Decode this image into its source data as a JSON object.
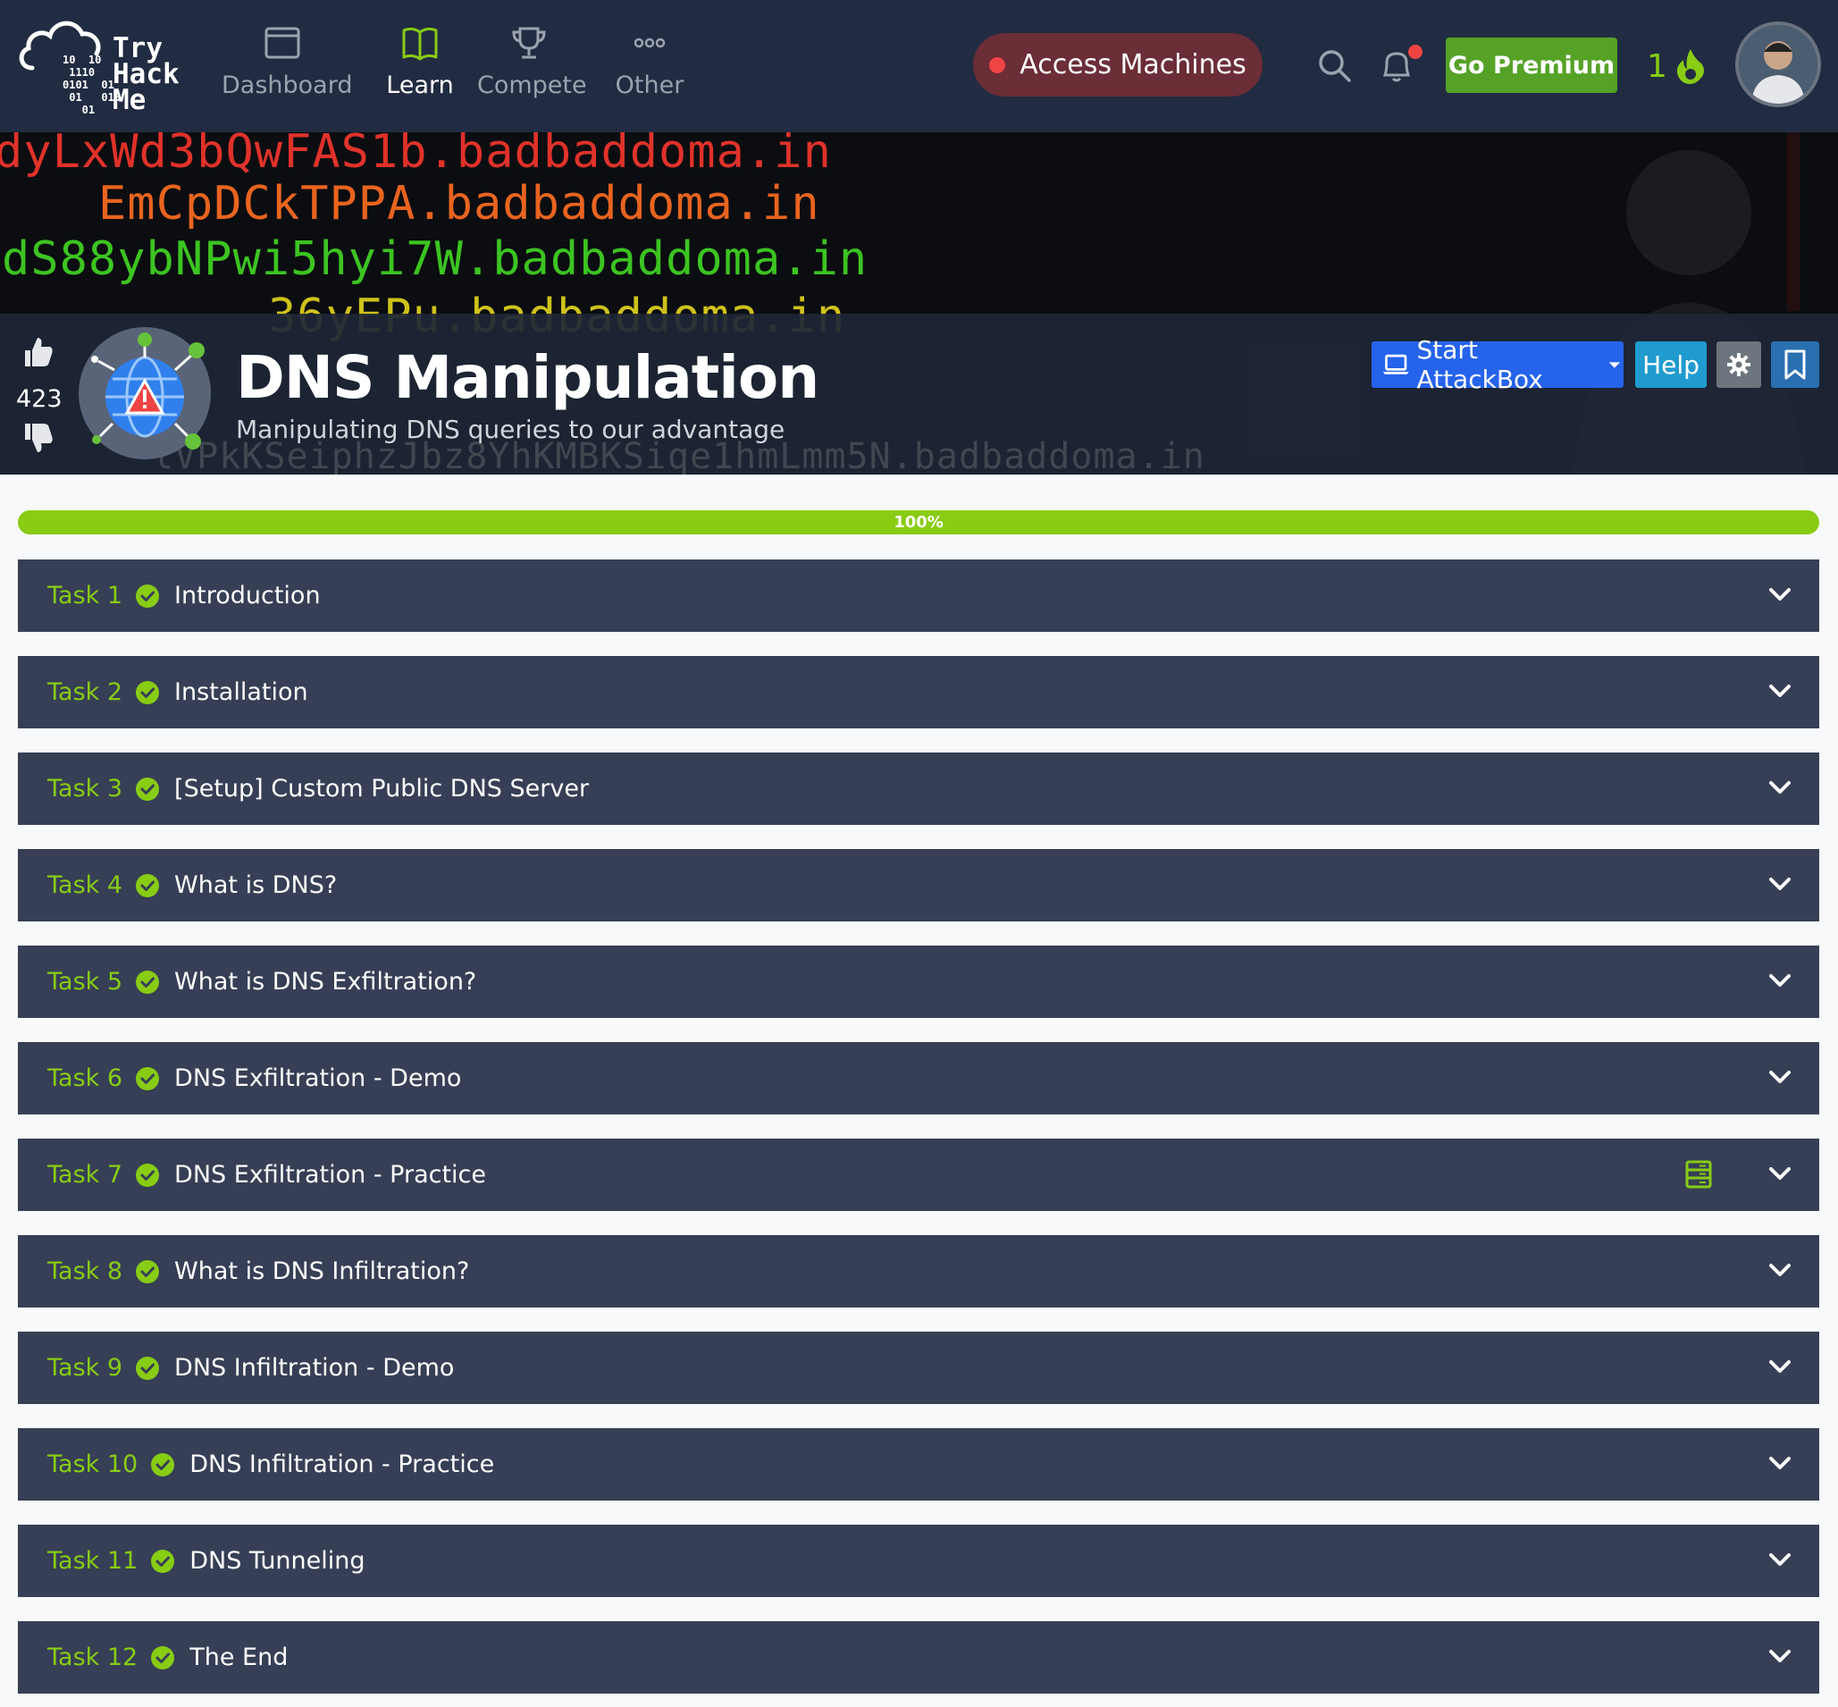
{
  "navbar": {
    "logo": {
      "line1": "Try",
      "line2": "Hack",
      "line3": "Me",
      "bits": "10  10\n 1110\n0101  01\n 01   010\n   01"
    },
    "items": [
      {
        "label": "Dashboard",
        "icon": "dashboard-icon",
        "active": false
      },
      {
        "label": "Learn",
        "icon": "book-icon",
        "active": true
      },
      {
        "label": "Compete",
        "icon": "trophy-icon",
        "active": false
      },
      {
        "label": "Other",
        "icon": "more-icon",
        "active": false
      }
    ],
    "access_machines": "Access Machines",
    "go_premium": "Go Premium",
    "streak": "1",
    "colors": {
      "bg": "#212c42",
      "accent": "#88cc14",
      "premium": "#55a227",
      "access": "#6b2d36"
    }
  },
  "hero": {
    "bg_lines": [
      {
        "text": "dyLxWd3bQwFAS1b.badbaddoma.in",
        "color": "#e0322a"
      },
      {
        "text": "EmCpDCkTPPA.badbaddoma.in",
        "color": "#e8641f"
      },
      {
        "text": "dS88ybNPwi5hyi7W.badbaddoma.in",
        "color": "#3cc421"
      },
      {
        "text": "36yEPu.badbaddoma.in",
        "color": "#cfc21b"
      },
      {
        "text": "lVPkKSeiphzJbz8YhKMBKSiqe1hmLmm5N.badbaddoma.in",
        "color": "#888888"
      }
    ],
    "likes": "423",
    "title": "DNS Manipulation",
    "subtitle": "Manipulating DNS queries to our advantage",
    "buttons": {
      "attackbox": "Start AttackBox",
      "help": "Help"
    }
  },
  "progress": {
    "label": "100%",
    "value": 1.0
  },
  "tasks": [
    {
      "num": "Task 1",
      "title": "Introduction"
    },
    {
      "num": "Task 2",
      "title": "Installation"
    },
    {
      "num": "Task 3",
      "title": "[Setup] Custom Public DNS Server"
    },
    {
      "num": "Task 4",
      "title": "What is DNS?"
    },
    {
      "num": "Task 5",
      "title": "What is DNS Exfiltration?"
    },
    {
      "num": "Task 6",
      "title": "DNS Exfiltration - Demo"
    },
    {
      "num": "Task 7",
      "title": "DNS Exfiltration - Practice",
      "server_icon": true
    },
    {
      "num": "Task 8",
      "title": "What is DNS Infiltration?"
    },
    {
      "num": "Task 9",
      "title": "DNS Infiltration - Demo"
    },
    {
      "num": "Task 10",
      "title": "DNS Infiltration - Practice"
    },
    {
      "num": "Task 11",
      "title": "DNS Tunneling"
    },
    {
      "num": "Task 12",
      "title": "The End"
    }
  ]
}
